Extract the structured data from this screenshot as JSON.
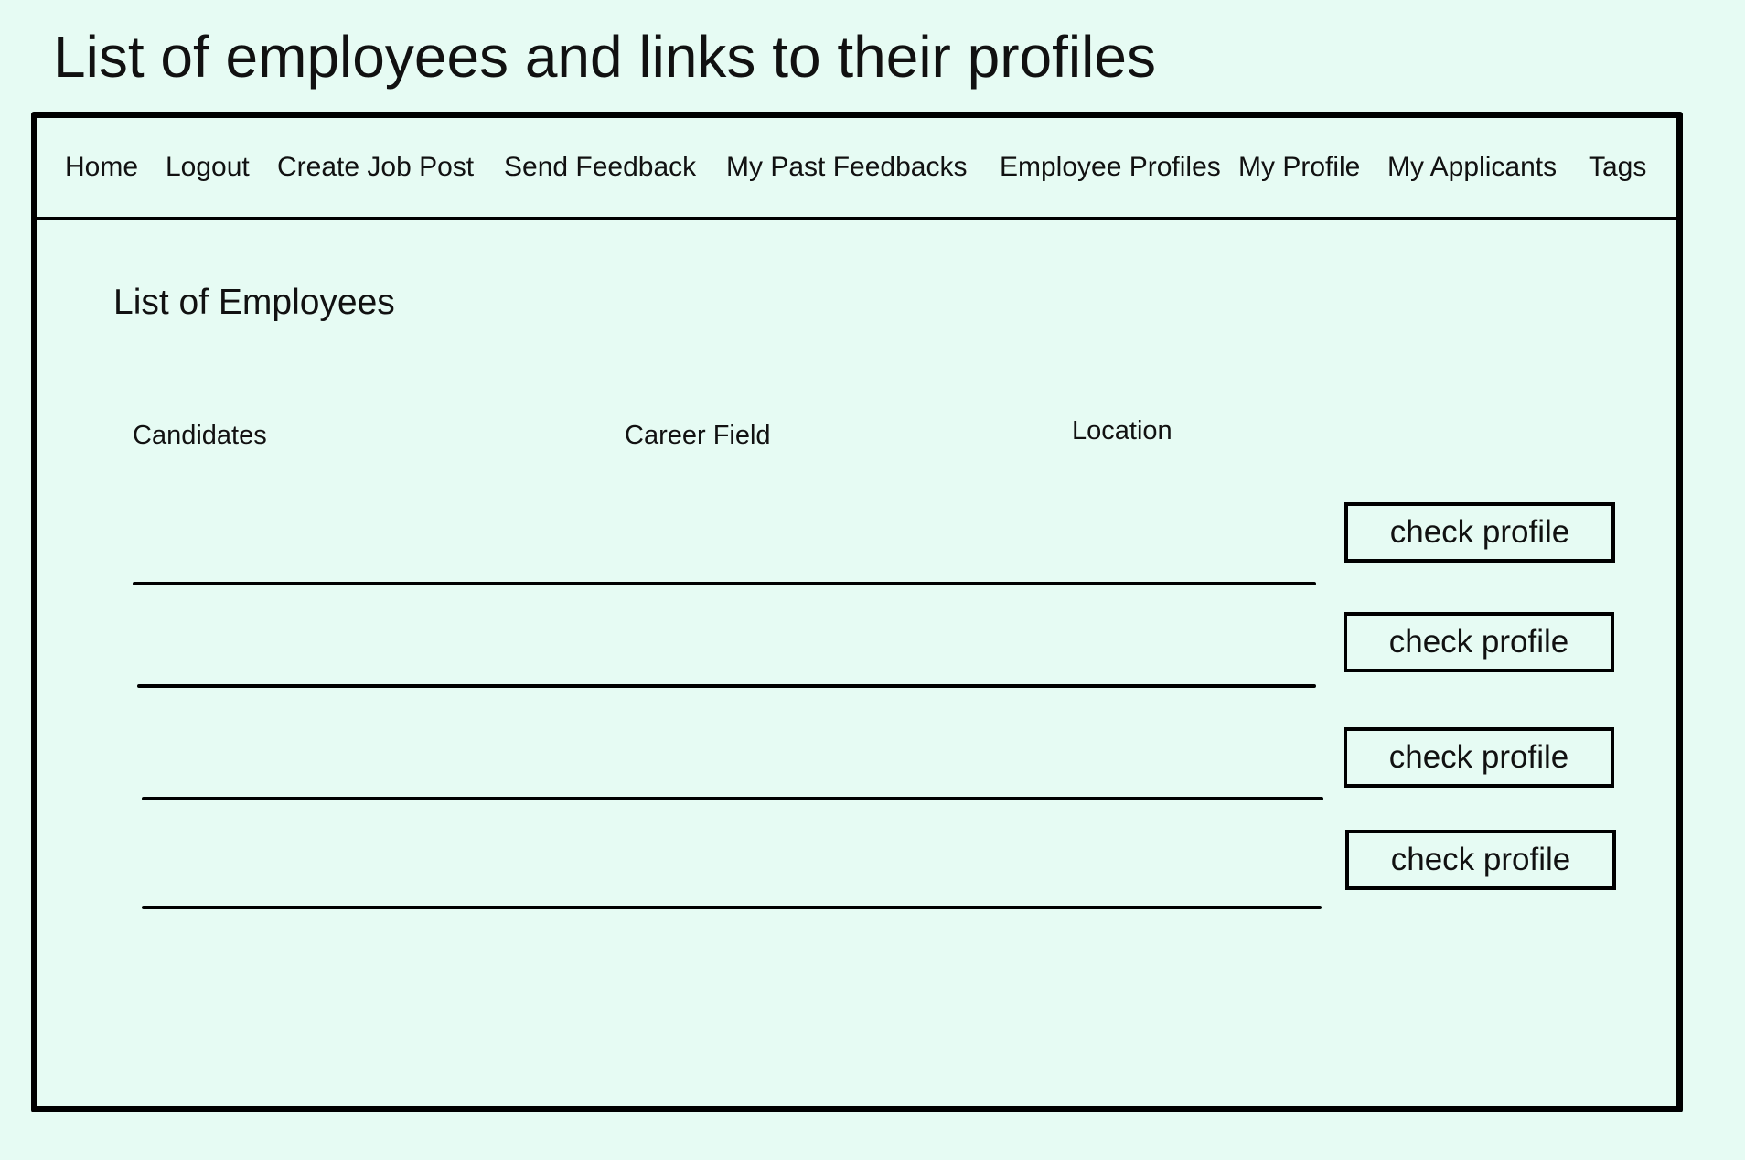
{
  "page": {
    "title": "List of employees and links to their profiles"
  },
  "nav": {
    "items": [
      {
        "label": "Home"
      },
      {
        "label": "Logout"
      },
      {
        "label": "Create Job Post"
      },
      {
        "label": "Send Feedback"
      },
      {
        "label": "My Past Feedbacks"
      },
      {
        "label": "Employee Profiles"
      },
      {
        "label": "My Profile"
      },
      {
        "label": "My Applicants"
      },
      {
        "label": "Tags"
      }
    ]
  },
  "main": {
    "section_title": "List of Employees",
    "columns": [
      "Candidates",
      "Career Field",
      "Location"
    ],
    "rows": [
      {
        "button_label": "check profile"
      },
      {
        "button_label": "check profile"
      },
      {
        "button_label": "check profile"
      },
      {
        "button_label": "check profile"
      }
    ]
  },
  "colors": {
    "background": "#e6fbf3",
    "border": "#000000",
    "text": "#111111"
  }
}
